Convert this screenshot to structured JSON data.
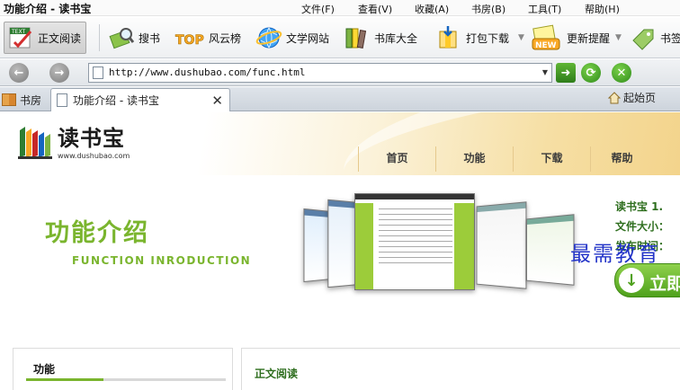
{
  "window": {
    "title": "功能介绍 - 读书宝",
    "menus": [
      "文件(F)",
      "查看(V)",
      "收藏(A)",
      "书房(B)",
      "工具(T)",
      "帮助(H)"
    ]
  },
  "toolbar": {
    "items": [
      {
        "label": "正文阅读",
        "icon": "text-read-icon"
      },
      {
        "label": "搜书",
        "icon": "search-book-icon"
      },
      {
        "label": "风云榜",
        "icon": "top-ranking-icon"
      },
      {
        "label": "文学网站",
        "icon": "literature-sites-icon"
      },
      {
        "label": "书库大全",
        "icon": "library-icon"
      },
      {
        "label": "打包下载",
        "icon": "package-download-icon"
      },
      {
        "label": "更新提醒",
        "icon": "new-update-icon"
      },
      {
        "label": "书签",
        "icon": "bookmark-tag-icon"
      }
    ],
    "text_badge": "TEXT",
    "top_badge": "TOP",
    "new_badge": "NEW"
  },
  "addressbar": {
    "url": "http://www.dushubao.com/func.html"
  },
  "tabs": {
    "bookroom": "书房",
    "active": "功能介绍 - 读书宝",
    "home": "起始页"
  },
  "site": {
    "logo_text": "读书宝",
    "logo_url": "www.dushubao.com",
    "nav": [
      "首页",
      "功能",
      "下载",
      "帮助"
    ],
    "hero_title": "功能介绍",
    "hero_subtitle": "FUNCTION INRODUCTION",
    "info": {
      "name": "读书宝  1.",
      "size_label": "文件大小：",
      "date_label": "发布时间："
    },
    "download_label": "立即",
    "side_title": "功能",
    "main_title": "正文阅读"
  },
  "watermark": "最需教育",
  "colors": {
    "accent_green": "#7ab52e",
    "dark_green": "#2e6e1e",
    "watermark_blue": "#2233c8"
  }
}
